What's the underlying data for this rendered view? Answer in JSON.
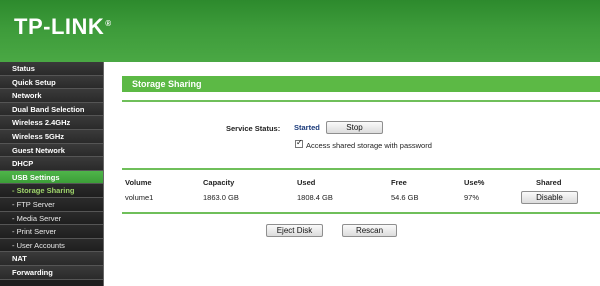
{
  "header": {
    "logo": "TP-LINK",
    "trademark": "®"
  },
  "sidebar": {
    "items": [
      {
        "label": "Status",
        "type": "top"
      },
      {
        "label": "Quick Setup",
        "type": "top"
      },
      {
        "label": "Network",
        "type": "top"
      },
      {
        "label": "Dual Band Selection",
        "type": "top"
      },
      {
        "label": "Wireless 2.4GHz",
        "type": "top"
      },
      {
        "label": "Wireless 5GHz",
        "type": "top"
      },
      {
        "label": "Guest Network",
        "type": "top"
      },
      {
        "label": "DHCP",
        "type": "top"
      },
      {
        "label": "USB Settings",
        "type": "active"
      },
      {
        "label": "- Storage Sharing",
        "type": "sub-current"
      },
      {
        "label": "- FTP Server",
        "type": "sub"
      },
      {
        "label": "- Media Server",
        "type": "sub"
      },
      {
        "label": "- Print Server",
        "type": "sub"
      },
      {
        "label": "- User Accounts",
        "type": "sub"
      },
      {
        "label": "NAT",
        "type": "top"
      },
      {
        "label": "Forwarding",
        "type": "top"
      }
    ]
  },
  "main": {
    "title": "Storage Sharing",
    "service_status_label": "Service Status:",
    "service_status_value": "Started",
    "stop_button": "Stop",
    "access_checkbox_label": "Access shared storage with password",
    "access_checked": true,
    "table": {
      "headers": [
        "Volume",
        "Capacity",
        "Used",
        "Free",
        "Use%",
        "Shared"
      ],
      "rows": [
        {
          "volume": "volume1",
          "capacity": "1863.0 GB",
          "used": "1808.4 GB",
          "free": "54.6 GB",
          "use_pct": "97%",
          "shared_button": "Disable"
        }
      ]
    },
    "eject_button": "Eject Disk",
    "rescan_button": "Rescan"
  },
  "colors": {
    "brand_green": "#3d9b3a",
    "title_green": "#5cb945",
    "sidebar_dark": "#1e1e1e",
    "status_blue": "#1a3a7a"
  }
}
